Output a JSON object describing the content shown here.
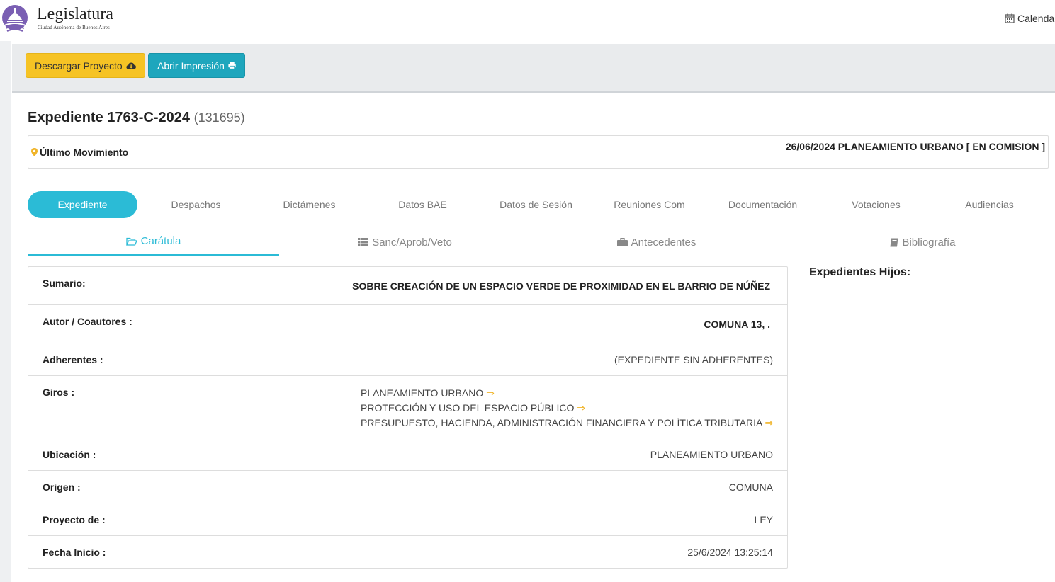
{
  "header": {
    "brand_title": "Legislatura",
    "brand_subtitle": "Ciudad Autónoma de Buenos Aires",
    "calendar_label": "Calendar",
    "logo_icon": "dome-logo-icon"
  },
  "toolbar": {
    "download_label": "Descargar Proyecto",
    "download_icon": "cloud-download-icon",
    "print_label": "Abrir Impresión",
    "print_icon": "printer-icon"
  },
  "expediente": {
    "title": "Expediente 1763-C-2024",
    "id_number": "(131695)"
  },
  "movement": {
    "label": "Último Movimiento",
    "value": "26/06/2024 PLANEAMIENTO URBANO [ EN COMISION ]"
  },
  "main_tabs": [
    {
      "label": "Expediente",
      "active": true
    },
    {
      "label": "Despachos"
    },
    {
      "label": "Dictámenes"
    },
    {
      "label": "Datos BAE"
    },
    {
      "label": "Datos de Sesión"
    },
    {
      "label": "Reuniones Com"
    },
    {
      "label": "Documentación"
    },
    {
      "label": "Votaciones"
    },
    {
      "label": "Audiencias"
    }
  ],
  "sub_tabs": [
    {
      "label": "Carátula",
      "icon": "folder-open-icon",
      "active": true
    },
    {
      "label": "Sanc/Aprob/Veto",
      "icon": "list-icon"
    },
    {
      "label": "Antecedentes",
      "icon": "briefcase-icon"
    },
    {
      "label": "Bibliografía",
      "icon": "book-icon"
    }
  ],
  "details": {
    "sumario_label": "Sumario:",
    "sumario_value": "SOBRE CREACIÓN DE UN ESPACIO VERDE DE PROXIMIDAD EN EL BARRIO DE NÚÑEZ",
    "autor_label": "Autor / Coautores :",
    "autor_value": "COMUNA 13, .",
    "adherentes_label": "Adherentes :",
    "adherentes_value": "(EXPEDIENTE SIN ADHERENTES)",
    "giros_label": "Giros :",
    "giros": [
      "PLANEAMIENTO URBANO",
      "PROTECCIÓN Y USO DEL ESPACIO PÚBLICO",
      "PRESUPUESTO, HACIENDA, ADMINISTRACIÓN FINANCIERA Y POLÍTICA TRIBUTARIA"
    ],
    "giro_arrow": "⇒",
    "ubicacion_label": "Ubicación :",
    "ubicacion_value": "PLANEAMIENTO URBANO",
    "origen_label": "Origen :",
    "origen_value": "COMUNA",
    "proyecto_label": "Proyecto de :",
    "proyecto_value": "LEY",
    "fecha_label": "Fecha Inicio :",
    "fecha_value": "25/6/2024 13:25:14"
  },
  "side": {
    "hijos_title": "Expedientes Hijos:"
  },
  "colors": {
    "accent": "#2bbbd6",
    "download_button": "#f6c324",
    "print_button": "#1ea6bd",
    "logo": "#7a5fb3"
  }
}
